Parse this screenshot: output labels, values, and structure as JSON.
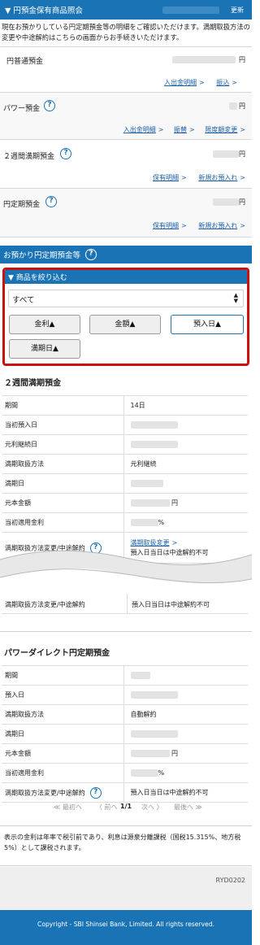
{
  "top_section": {
    "title": "▼ 円預金保有商品照会",
    "refresh_label": "更新",
    "description": "現在お預かりしている円定期預金等の明細をご確認いただけます。満期取扱方法の変更や中途解約はこちらの画面からお手続きいただけます。"
  },
  "accounts": [
    {
      "name": "円普通預金",
      "unit": "円",
      "links": [
        "入出金明細",
        "振込"
      ],
      "help": false
    },
    {
      "name": "パワー預金",
      "unit": "円",
      "links": [
        "入出金明細",
        "振替",
        "限度額変更"
      ],
      "help": true
    },
    {
      "name": "２週間満期預金",
      "unit": "円",
      "links": [
        "保有明細",
        "新規お預入れ"
      ],
      "help": true
    },
    {
      "name": "円定期預金",
      "unit": "円",
      "links": [
        "保有明細",
        "新規お預入れ"
      ],
      "help": true
    }
  ],
  "time_deposit_section": {
    "title": "お預かり円定期預金等"
  },
  "filter": {
    "title": "▼ 商品を絞り込む",
    "select_value": "すべて",
    "sort_buttons": [
      "金利▲",
      "金額▲",
      "預入日▲",
      "満期日▲"
    ],
    "active_sort": "預入日▲"
  },
  "product1": {
    "title": "２週間満期預金",
    "rows": [
      {
        "label": "期間",
        "value": "14日"
      },
      {
        "label": "当初預入日",
        "value": ""
      },
      {
        "label": "元利継続日",
        "value": ""
      },
      {
        "label": "満期取扱方法",
        "value": "元利継続"
      },
      {
        "label": "満期日",
        "value": ""
      },
      {
        "label": "元本金額",
        "value": "",
        "unit": "円"
      },
      {
        "label": "当初適用金利",
        "value": "",
        "unit": "%"
      }
    ],
    "change_label": "満期取扱方法変更/中途解約",
    "change_link": "満期取扱変更",
    "change_note": "預入日当日は中途解約不可"
  },
  "torn_row": {
    "label": "満期取扱方法変更/中途解約",
    "note": "預入日当日は中途解約不可"
  },
  "product2": {
    "title": "パワーダイレクト円定期預金",
    "rows": [
      {
        "label": "期間",
        "value": ""
      },
      {
        "label": "預入日",
        "value": ""
      },
      {
        "label": "満期取扱方法",
        "value": "自動解約"
      },
      {
        "label": "満期日",
        "value": ""
      },
      {
        "label": "元本金額",
        "value": "",
        "unit": "円"
      },
      {
        "label": "当初適用金利",
        "value": "",
        "unit": "%"
      },
      {
        "label": "満期取扱方法変更/中途解約",
        "value": "預入日当日は中途解約不可"
      }
    ]
  },
  "pagination": {
    "first": "≪ 最初へ",
    "prev": "〈 前へ",
    "current": "1/1",
    "next": "次へ 〉",
    "last": "最後へ ≫"
  },
  "footnote": "表示の金利は年率で税引前であり、利息は源泉分離課税（国税15.315%、地方税5%）として課税されます。",
  "screen_id": "RYD0202",
  "footer": {
    "copyright": "Copyright - SBI Shinsei Bank, Limited. All rights reserved."
  },
  "colors": {
    "primary": "#1a73b4",
    "highlight_border": "#cc1111",
    "link": "#1a5fa8"
  }
}
